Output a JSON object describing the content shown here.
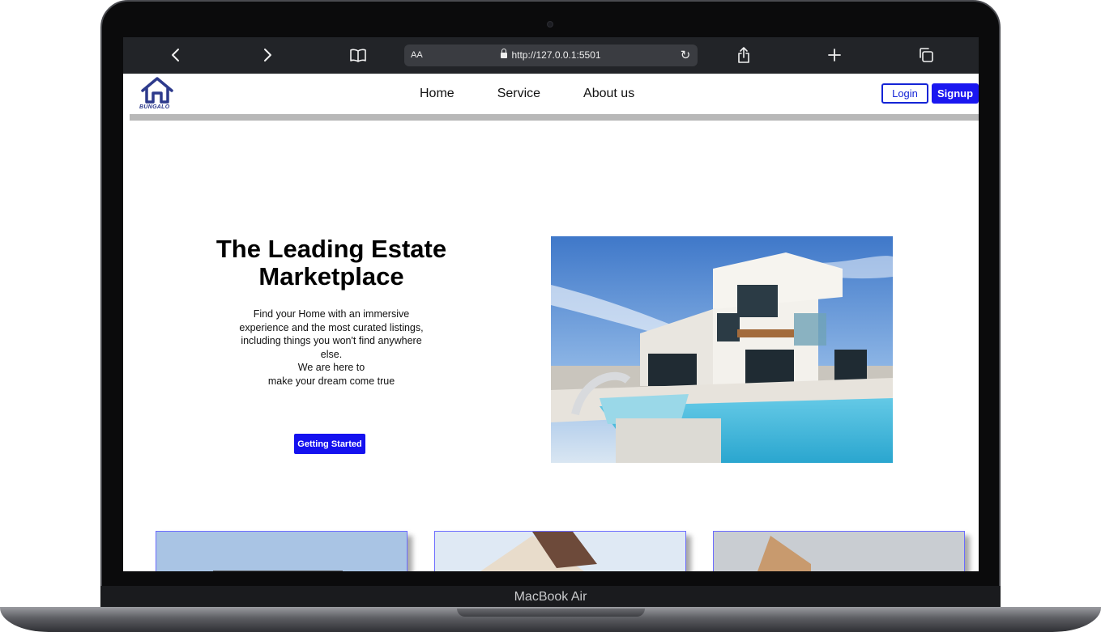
{
  "browser": {
    "aa_label": "AA",
    "url": "http://127.0.0.1:5501"
  },
  "site": {
    "logo_text": "BUNGALO",
    "nav": [
      "Home",
      "Service",
      "About us"
    ],
    "login_label": "Login",
    "signup_label": "Signup"
  },
  "hero": {
    "title": "The Leading Estate Marketplace",
    "description_lines": [
      "Find your Home with an immersive",
      "experience and the most curated listings,",
      "including things you won't find anywhere",
      "else.",
      "We are here to",
      "make your dream come true"
    ],
    "cta_label": "Getting Started"
  },
  "device": {
    "label": "MacBook Air"
  },
  "colors": {
    "accent": "#1a17f0",
    "toolbar": "#222428"
  }
}
